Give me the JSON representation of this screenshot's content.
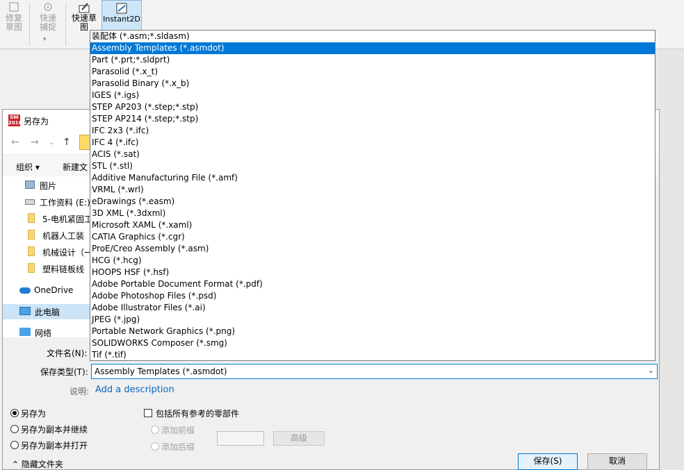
{
  "ribbon": {
    "repair_sketch": "修复草图",
    "quick_snap": "快速捕捉",
    "quick_sketch": "快速草图",
    "instant2d": "Instant2D"
  },
  "dialog": {
    "title": "另存为",
    "organize": "组织 ▾",
    "new_folder": "新建文",
    "nav_items": [
      {
        "label": "图片",
        "icon": "pictures-icon"
      },
      {
        "label": "工作资料 (E:)",
        "icon": "drive-icon"
      },
      {
        "label": "5-电机紧固工",
        "icon": "folder-icon"
      },
      {
        "label": "机器人工装",
        "icon": "folder-icon"
      },
      {
        "label": "机械设计（一",
        "icon": "folder-icon"
      },
      {
        "label": "塑料链板线",
        "icon": "folder-icon"
      },
      {
        "label": "OneDrive",
        "icon": "onedrive-icon"
      },
      {
        "label": "此电脑",
        "icon": "computer-icon"
      },
      {
        "label": "网络",
        "icon": "network-icon"
      }
    ],
    "file_name_label": "文件名(N):",
    "file_type_label": "保存类型(T):",
    "file_type_value": "Assembly Templates (*.asmdot)",
    "description_label": "说明:",
    "description_link": "Add a description",
    "options": {
      "save_as": "另存为",
      "save_as_copy_continue": "另存为副本并继续",
      "save_as_copy_open": "另存为副本并打开",
      "include_refs": "包括所有参考的零部件",
      "add_prefix": "添加前缀",
      "add_suffix": "添加后缀",
      "advanced": "高级"
    },
    "hide_folders": "隐藏文件夹",
    "save_button": "保存(S)",
    "cancel_button": "取消"
  },
  "dropdown": {
    "selected_index": 1,
    "items": [
      "装配体 (*.asm;*.sldasm)",
      "Assembly Templates (*.asmdot)",
      "Part (*.prt;*.sldprt)",
      "Parasolid (*.x_t)",
      "Parasolid Binary (*.x_b)",
      "IGES (*.igs)",
      "STEP AP203 (*.step;*.stp)",
      "STEP AP214 (*.step;*.stp)",
      "IFC 2x3 (*.ifc)",
      "IFC 4 (*.ifc)",
      "ACIS (*.sat)",
      "STL (*.stl)",
      "Additive Manufacturing File (*.amf)",
      "VRML (*.wrl)",
      "eDrawings (*.easm)",
      "3D XML (*.3dxml)",
      "Microsoft XAML (*.xaml)",
      "CATIA Graphics (*.cgr)",
      "ProE/Creo Assembly (*.asm)",
      "HCG (*.hcg)",
      "HOOPS HSF (*.hsf)",
      "Adobe Portable Document Format (*.pdf)",
      "Adobe Photoshop Files  (*.psd)",
      "Adobe Illustrator Files (*.ai)",
      "JPEG (*.jpg)",
      "Portable Network Graphics (*.png)",
      "SOLIDWORKS Composer (*.smg)",
      "Tif (*.tif)"
    ]
  },
  "colors": {
    "accent": "#0078d7",
    "link": "#0b63c4",
    "selection_bg": "#0078d7"
  }
}
